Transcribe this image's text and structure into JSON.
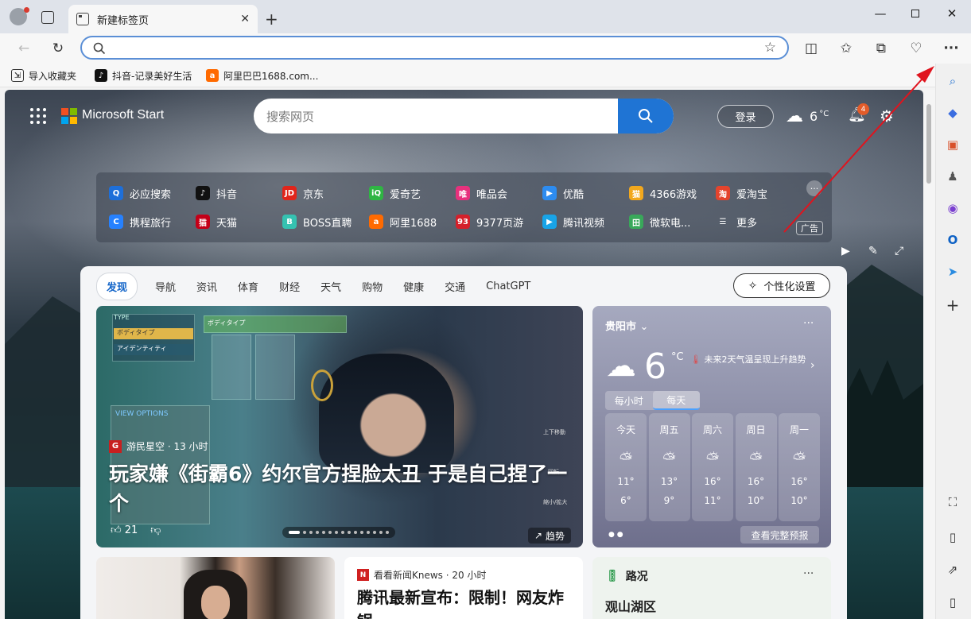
{
  "browser": {
    "tab_title": "新建标签页",
    "address_placeholder": "",
    "bookmarks": [
      {
        "label": "导入收藏夹",
        "icon": "import-icon"
      },
      {
        "label": "抖音-记录美好生活",
        "icon": "douyin-icon"
      },
      {
        "label": "阿里巴巴1688.com...",
        "icon": "alibaba-icon"
      }
    ]
  },
  "header": {
    "brand": "Microsoft Start",
    "search_placeholder": "搜索网页",
    "login": "登录",
    "temperature": "6",
    "temp_unit": "°C",
    "notifications": "4"
  },
  "quicklinks": {
    "row1": [
      {
        "label": "必应搜索",
        "icon_color": "#1e6fd9",
        "glyph": "Q"
      },
      {
        "label": "抖音",
        "icon_color": "#111111",
        "glyph": "♪"
      },
      {
        "label": "京东",
        "icon_color": "#e1251b",
        "glyph": "JD"
      },
      {
        "label": "爱奇艺",
        "icon_color": "#2fb543",
        "glyph": "iQ"
      },
      {
        "label": "唯品会",
        "icon_color": "#e7317d",
        "glyph": "唯"
      },
      {
        "label": "优酷",
        "icon_color": "#2d8cf0",
        "glyph": "▶"
      },
      {
        "label": "4366游戏",
        "icon_color": "#f2a81d",
        "glyph": "猫"
      },
      {
        "label": "爱淘宝",
        "icon_color": "#e4442d",
        "glyph": "淘"
      }
    ],
    "row2": [
      {
        "label": "携程旅行",
        "icon_color": "#2681ff",
        "glyph": "C"
      },
      {
        "label": "天猫",
        "icon_color": "#c40018",
        "glyph": "猫"
      },
      {
        "label": "BOSS直聘",
        "icon_color": "#35c2b1",
        "glyph": "B"
      },
      {
        "label": "阿里1688",
        "icon_color": "#ff6a00",
        "glyph": "a"
      },
      {
        "label": "9377页游",
        "icon_color": "#d4202b",
        "glyph": "93"
      },
      {
        "label": "腾讯视频",
        "icon_color": "#18a4e8",
        "glyph": "▶"
      },
      {
        "label": "微软电...",
        "icon_color": "#39a85a",
        "glyph": "田"
      },
      {
        "label": "更多",
        "icon_color": "transparent",
        "glyph": "☰"
      }
    ],
    "ad_label": "广告"
  },
  "feed": {
    "tabs": [
      "发现",
      "导航",
      "资讯",
      "体育",
      "财经",
      "天气",
      "购物",
      "健康",
      "交通",
      "ChatGPT"
    ],
    "personalize": "个性化设置",
    "hero": {
      "source": "游民星空 · 13 小时",
      "title": "玩家嫌《街霸6》约尔官方捏脸太丑 于是自己捏了一个",
      "likes": "21",
      "trend": "趋势",
      "game_ui_labels": [
        "TYPE",
        "ボディタイプ",
        "アイデンティティ",
        "ボディタイプ",
        "VIEW OPTIONS",
        "上下移動",
        "回転",
        "縮小/拡大"
      ]
    },
    "weather": {
      "city": "贵阳市",
      "temp": "6",
      "unit": "°C",
      "alert": "未来2天气温呈现上升趋势",
      "tab_hourly": "每小时",
      "tab_daily": "每天",
      "days": [
        {
          "day": "今天",
          "hi": "11°",
          "lo": "6°"
        },
        {
          "day": "周五",
          "hi": "13°",
          "lo": "9°"
        },
        {
          "day": "周六",
          "hi": "16°",
          "lo": "11°"
        },
        {
          "day": "周日",
          "hi": "16°",
          "lo": "10°"
        },
        {
          "day": "周一",
          "hi": "16°",
          "lo": "10°"
        }
      ],
      "full_forecast": "查看完整预报"
    },
    "news2": {
      "source": "看看新闻Knews · 20 小时",
      "title": "腾讯最新宣布：限制！网友炸锅"
    },
    "traffic": {
      "heading": "路况",
      "place": "观山湖区"
    }
  },
  "colors": {
    "accent": "#1f74d4",
    "red_arrow": "#e0141e"
  }
}
